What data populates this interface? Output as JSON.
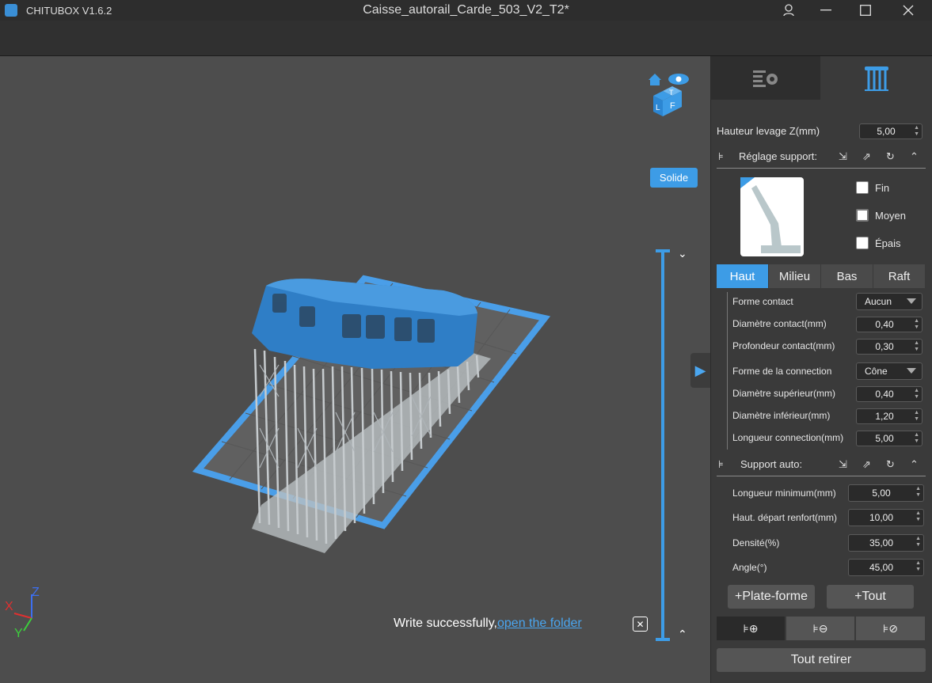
{
  "app": {
    "name": "CHITUBOX V1.6.2",
    "document_title": "Caisse_autorail_Carde_503_V2_T2*"
  },
  "viewport": {
    "render_mode": "Solide",
    "toast": {
      "text": "Write successfully,",
      "link": "open the folder",
      "close_icon": "close-icon"
    },
    "axes": {
      "x": "X",
      "y": "Y",
      "z": "Z"
    },
    "view_cube_faces": {
      "top": "T",
      "left": "L",
      "front": "F"
    }
  },
  "panel": {
    "tabs": [
      {
        "icon": "settings-list-icon"
      },
      {
        "icon": "support-icon"
      }
    ],
    "lift_height": {
      "label": "Hauteur levage Z(mm)",
      "value": "5,00"
    },
    "support_settings": {
      "label": "Réglage support:"
    },
    "presets": [
      {
        "label": "Fin"
      },
      {
        "label": "Moyen"
      },
      {
        "label": "Épais"
      }
    ],
    "subtabs": [
      {
        "label": "Haut"
      },
      {
        "label": "Milieu"
      },
      {
        "label": "Bas"
      },
      {
        "label": "Raft"
      }
    ],
    "contact": {
      "shape_label": "Forme contact",
      "shape_value": "Aucun",
      "diameter_label": "Diamètre contact(mm)",
      "diameter_value": "0,40",
      "depth_label": "Profondeur contact(mm)",
      "depth_value": "0,30"
    },
    "connection": {
      "shape_label": "Forme de la connection",
      "shape_value": "Cône",
      "top_diameter_label": "Diamètre supérieur(mm)",
      "top_diameter_value": "0,40",
      "bottom_diameter_label": "Diamètre inférieur(mm)",
      "bottom_diameter_value": "1,20",
      "length_label": "Longueur connection(mm)",
      "length_value": "5,00"
    },
    "auto_support": {
      "label": "Support auto:",
      "min_length_label": "Longueur minimum(mm)",
      "min_length_value": "5,00",
      "brace_start_label": "Haut. départ renfort(mm)",
      "brace_start_value": "10,00",
      "density_label": "Densité(%)",
      "density_value": "35,00",
      "angle_label": "Angle(°)",
      "angle_value": "45,00"
    },
    "buttons": {
      "platform": "+Plate-forme",
      "all": "+Tout",
      "remove_all": "Tout retirer"
    }
  },
  "colors": {
    "accent": "#3d9ce6",
    "viewport_bg": "#4d4d4d",
    "panel_bg": "#3a3a3a"
  }
}
